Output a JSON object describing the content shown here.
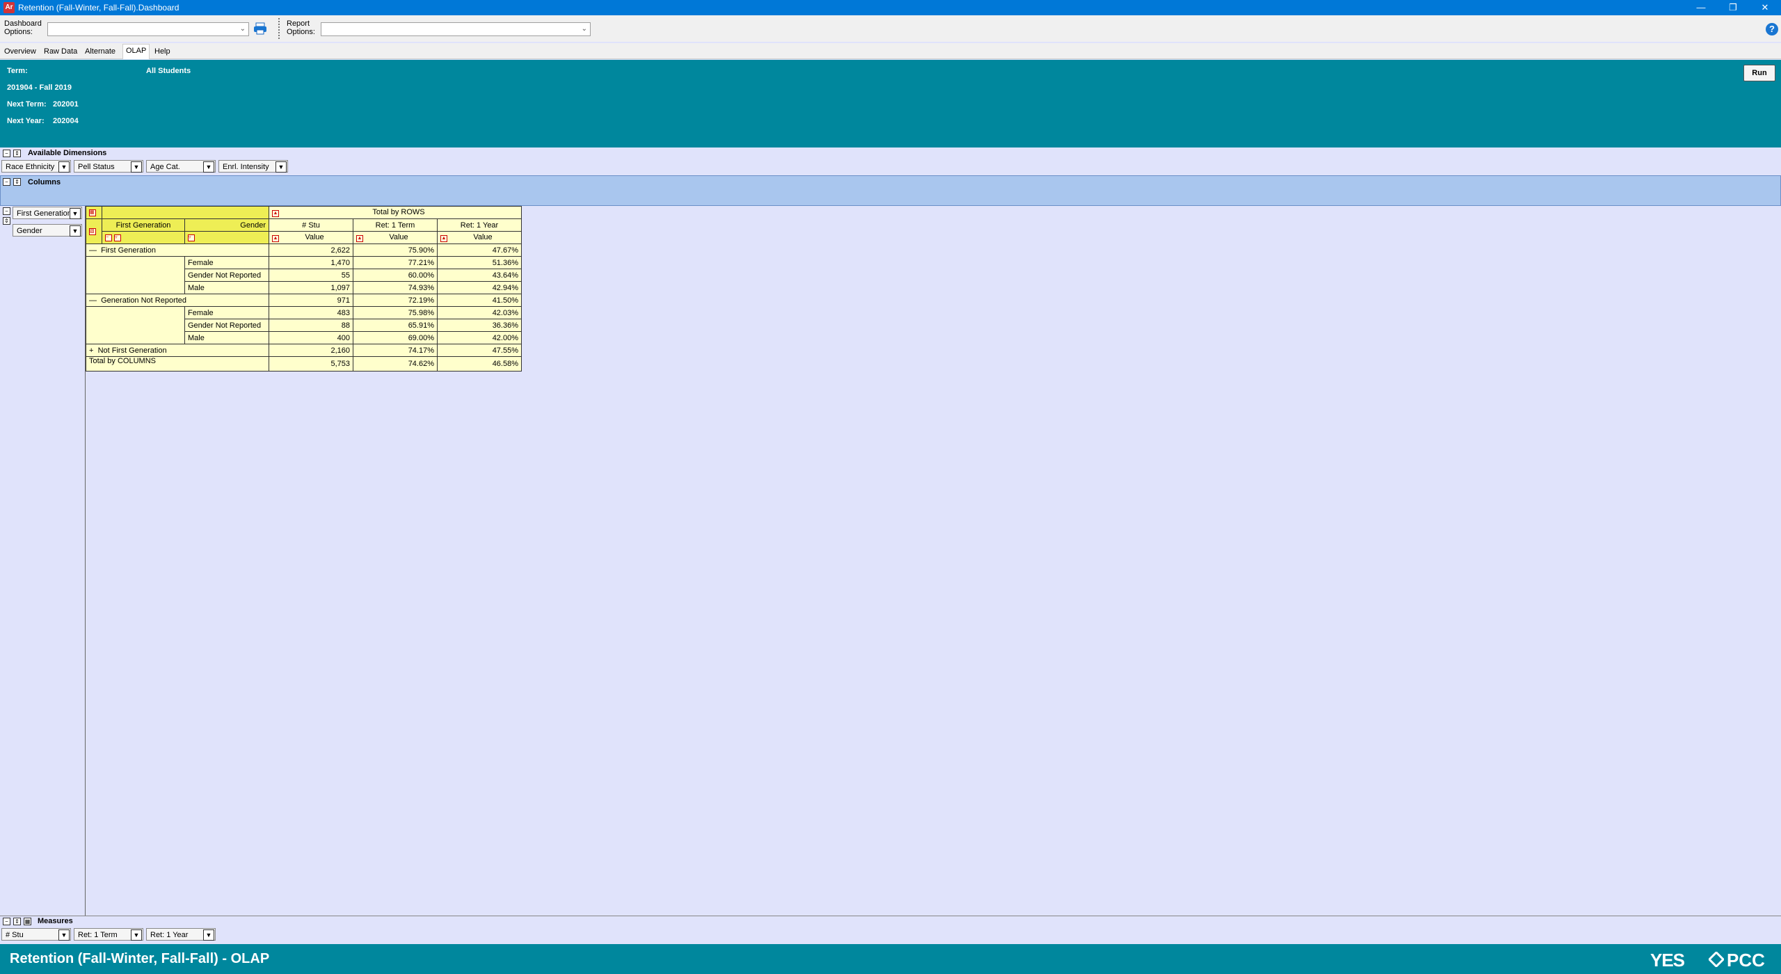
{
  "window": {
    "title": "Retention (Fall-Winter, Fall-Fall).Dashboard",
    "app_icon": "Ar"
  },
  "toolbar": {
    "dashboard_options_label_1": "Dashboard",
    "dashboard_options_label_2": "Options:",
    "dashboard_options_value": "",
    "report_options_label_1": "Report",
    "report_options_label_2": "Options:",
    "report_options_value": ""
  },
  "tabs": [
    "Overview",
    "Raw Data",
    "Alternate",
    "OLAP",
    "Help"
  ],
  "header": {
    "term_label": "Term:",
    "audience": "All Students",
    "term_value": "201904 - Fall 2019",
    "next_term_label": "Next Term:",
    "next_term_value": "202001",
    "next_year_label": "Next Year:",
    "next_year_value": "202004",
    "run_label": "Run"
  },
  "available_dimensions": {
    "title": "Available Dimensions",
    "items": [
      "Race Ethnicity",
      "Pell Status",
      "Age Cat.",
      "Enrl. Intensity"
    ]
  },
  "columns_section": {
    "title": "Columns"
  },
  "row_dimensions": [
    "First Generation",
    "Gender"
  ],
  "pivot": {
    "total_by_rows": "Total by ROWS",
    "row_header_1": "First Generation",
    "row_header_2": "Gender",
    "measures": [
      "# Stu",
      "Ret: 1 Term",
      "Ret: 1 Year"
    ],
    "value_label": "Value",
    "rows": [
      {
        "group": "First Generation",
        "sub": "",
        "values": [
          "2,622",
          "75.90%",
          "47.67%"
        ],
        "toggle": "—"
      },
      {
        "group": "",
        "sub": "Female",
        "values": [
          "1,470",
          "77.21%",
          "51.36%"
        ]
      },
      {
        "group": "",
        "sub": "Gender Not Reported",
        "values": [
          "55",
          "60.00%",
          "43.64%"
        ]
      },
      {
        "group": "",
        "sub": "Male",
        "values": [
          "1,097",
          "74.93%",
          "42.94%"
        ]
      },
      {
        "group": "Generation Not Reported",
        "sub": "",
        "values": [
          "971",
          "72.19%",
          "41.50%"
        ],
        "toggle": "—"
      },
      {
        "group": "",
        "sub": "Female",
        "values": [
          "483",
          "75.98%",
          "42.03%"
        ]
      },
      {
        "group": "",
        "sub": "Gender Not Reported",
        "values": [
          "88",
          "65.91%",
          "36.36%"
        ]
      },
      {
        "group": "",
        "sub": "Male",
        "values": [
          "400",
          "69.00%",
          "42.00%"
        ]
      },
      {
        "group": "Not First Generation",
        "sub": "",
        "values": [
          "2,160",
          "74.17%",
          "47.55%"
        ],
        "toggle": "+"
      }
    ],
    "total_label": "Total by COLUMNS",
    "total_values": [
      "5,753",
      "74.62%",
      "46.58%"
    ]
  },
  "measures_section": {
    "title": "Measures",
    "items": [
      "# Stu",
      "Ret: 1 Term",
      "Ret: 1 Year"
    ]
  },
  "footer": {
    "title": "Retention (Fall-Winter, Fall-Fall) - OLAP",
    "logo_1": "YES",
    "logo_2": "PCC"
  }
}
